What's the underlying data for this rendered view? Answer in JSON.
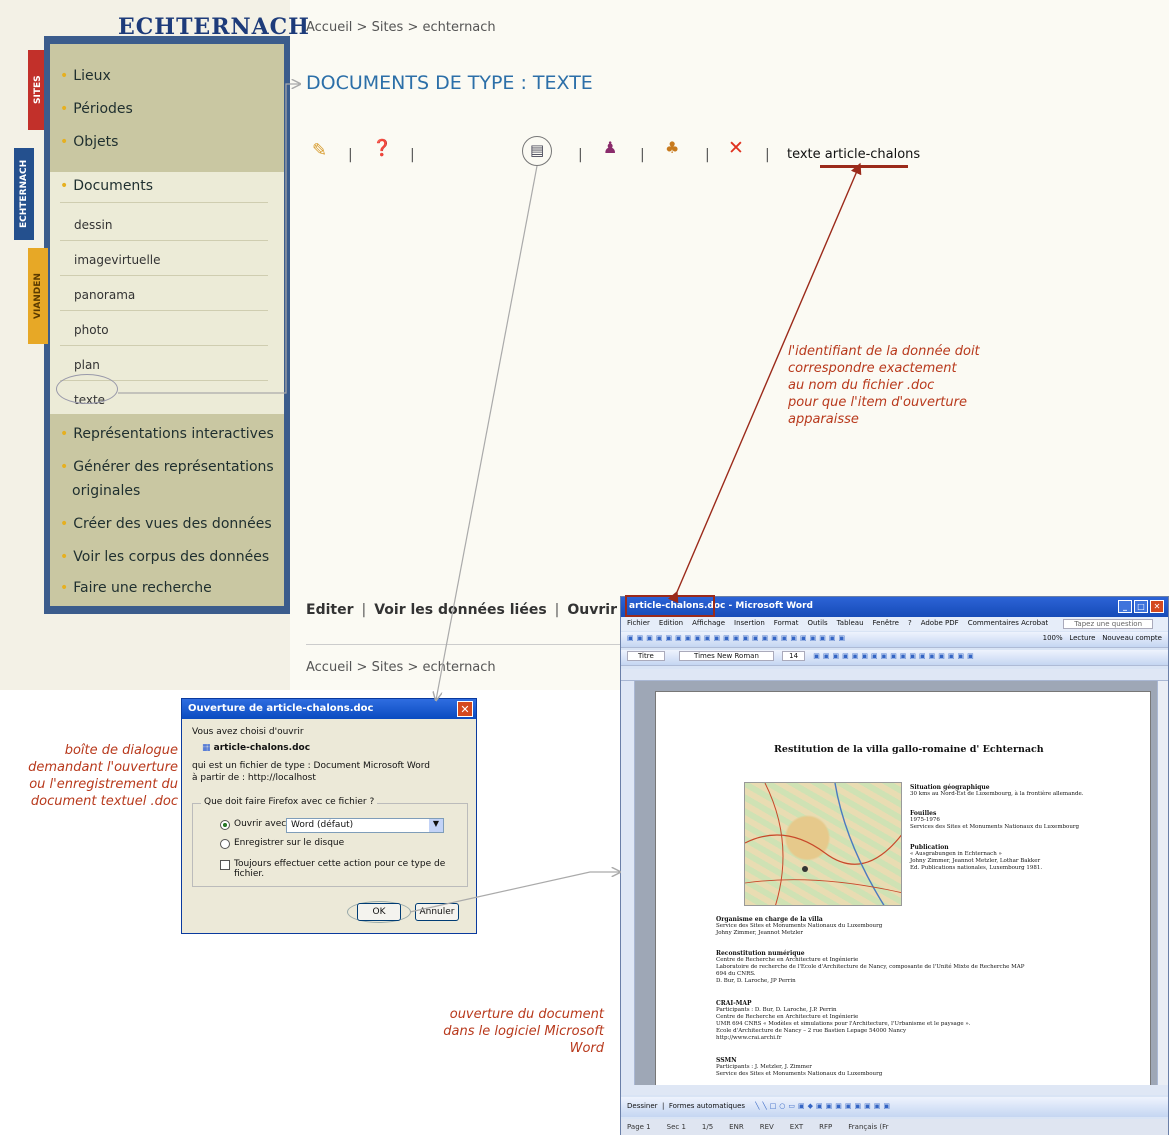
{
  "site": {
    "logo": "ECHTERNACH",
    "tabs": {
      "sites": "SITES",
      "echternach": "ECHTERNACH",
      "vianden": "VIANDEN"
    }
  },
  "sidebar": {
    "items": [
      "Lieux",
      "Périodes",
      "Objets",
      "Documents"
    ],
    "documents_sub": [
      "dessin",
      "imagevirtuelle",
      "panorama",
      "photo",
      "plan",
      "texte"
    ],
    "items_after": [
      "Représentations interactives",
      "Générer des représentations",
      "originales",
      "Créer des vues des données",
      "Voir les corpus des données",
      "Faire une recherche"
    ]
  },
  "breadcrumb": {
    "top": "Accueil > Sites > echternach",
    "bottom": "Accueil > Sites > echternach"
  },
  "page_title": "DOCUMENTS DE TYPE : TEXTE",
  "toolbar": {
    "sep": "|",
    "texte_prefix": "texte",
    "item_id": "article-chalons",
    "delete_icon": "✕"
  },
  "actions": {
    "edit": "Editer",
    "linked": "Voir les données liées",
    "open": "Ouvrir",
    "sep": "|"
  },
  "notes": {
    "identifier": [
      "l'identifiant de la donnée doit",
      "correspondre exactement",
      "au nom du fichier .doc",
      "pour que l'item d'ouverture",
      "apparaisse"
    ],
    "dialog": [
      "boîte de dialogue",
      "demandant l'ouverture",
      "ou l'enregistrement du",
      "document textuel .doc"
    ],
    "word": [
      "ouverture du document",
      "dans le logiciel Microsoft",
      "Word"
    ]
  },
  "dialog": {
    "title": "Ouverture de article-chalons.doc",
    "close": "✕",
    "chose_text": "Vous avez choisi d'ouvrir",
    "file_name": "article-chalons.doc",
    "type_line": "qui est un fichier de type : Document Microsoft Word",
    "from_line": "à partir de : http://localhost",
    "group_label": "Que doit faire Firefox avec ce fichier ?",
    "open_with_label": "Ouvrir avec",
    "open_with_value": "Word (défaut)",
    "save_label": "Enregistrer sur le disque",
    "always_label": "Toujours effectuer cette action pour ce type de fichier.",
    "ok": "OK",
    "cancel": "Annuler"
  },
  "word": {
    "title_file": "article-chalons.doc",
    "title_app": "- Microsoft Word",
    "menu": [
      "Fichier",
      "Edition",
      "Affichage",
      "Insertion",
      "Format",
      "Outils",
      "Tableau",
      "Fenêtre",
      "?",
      "Adobe PDF",
      "Commentaires Acrobat"
    ],
    "question_box": "Tapez une question",
    "toolbar1_right": [
      "100%",
      "Lecture",
      "Nouveau compte"
    ],
    "style_value": "Titre",
    "font_value": "Times New Roman",
    "size_value": "14",
    "drawbar": [
      "Dessiner",
      "Formes automatiques"
    ],
    "status": [
      "Page 1",
      "Sec 1",
      "1/5",
      "ENR",
      "REV",
      "EXT",
      "RFP",
      "Français (Fr"
    ],
    "doc": {
      "heading": "Restitution de la villa gallo-romaine d' Echternach",
      "situation_title": "Situation géographique",
      "situation_text": "30 kms au Nord-Est de Luxembourg, à la frontière allemande.",
      "fouilles_title": "Fouilles",
      "fouilles_text": [
        "1975-1976",
        "Services des Sites et Monuments Nationaux du Luxembourg"
      ],
      "publication_title": "Publication",
      "publication_text": [
        "« Ausgrabungen in Echternach »",
        "Johny Zimmer, Jeannot Metzler, Lothar Bakker",
        "Ed. Publications nationales, Luxembourg 1981."
      ],
      "organisme_title": "Organisme en charge de la villa",
      "organisme_text": [
        "Service des Sites et Monuments Nationaux du Luxembourg",
        "Johny Zimmer, Jeannot Metzler"
      ],
      "reconstitution_title": "Reconstitution numérique",
      "reconstitution_text": [
        "Centre de Recherche en Architecture et Ingénierie",
        "Laboratoire de recherche de l'Ecole d'Architecture de Nancy, composante de l'Unité Mixte de Recherche MAP",
        "694 du CNRS.",
        "D. Bur, D. Laroche, JP Perrin"
      ],
      "crai_title": "CRAI-MAP",
      "crai_text": [
        "Participants : D. Bur, D. Laroche, J.P. Perrin",
        "Centre de Recherche en Architecture et Ingénierie",
        "UMR 694 CNRS « Modèles et simulations pour l'Architecture, l'Urbanisme et le paysage ».",
        "Ecole d'Architecture de Nancy – 2 rue Bastien Lepage 54000 Nancy",
        "http://www.crai.archi.fr"
      ],
      "ssmn_title": "SSMN",
      "ssmn_text": [
        "Participants : J. Metzler, J. Zimmer",
        "Service des Sites et Monuments Nationaux du Luxembourg"
      ]
    }
  }
}
